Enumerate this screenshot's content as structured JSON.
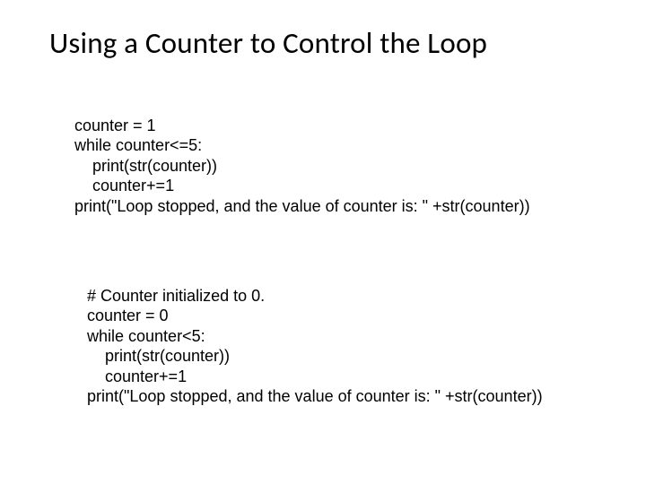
{
  "title": "Using a Counter to Control the Loop",
  "code1": {
    "l1": "counter = 1",
    "l2": "while counter<=5:",
    "l3": "    print(str(counter))",
    "l4": "    counter+=1",
    "l5": "print(\"Loop stopped, and the value of counter is: \" +str(counter))"
  },
  "code2": {
    "l1": "# Counter initialized to 0.",
    "l2": "counter = 0",
    "l3": "while counter<5:",
    "l4": "    print(str(counter))",
    "l5": "    counter+=1",
    "l6": "print(\"Loop stopped, and the value of counter is: \" +str(counter))"
  }
}
